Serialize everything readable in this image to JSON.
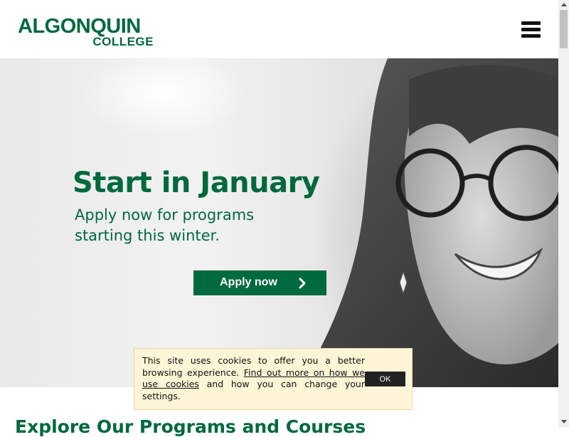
{
  "header": {
    "logo_main": "ALGONQUIN",
    "logo_sub": "COLLEGE"
  },
  "hero": {
    "headline": "Start in January",
    "sub_line1": "Apply now for programs",
    "sub_line2": "starting this winter.",
    "apply_label": "Apply now"
  },
  "section": {
    "title": "Explore Our Programs and Courses"
  },
  "cookie": {
    "text_before": "This site uses cookies to offer you a better browsing experience. ",
    "link_text": "Find out more on how we use cookies",
    "text_after": " and how you can change your settings.",
    "ok_label": "OK"
  },
  "colors": {
    "brand_green": "#00693e",
    "cookie_bg": "#fef5d6"
  },
  "icons": {
    "menu": "hamburger-menu-icon",
    "apply_arrow": "chevron-right-icon"
  }
}
